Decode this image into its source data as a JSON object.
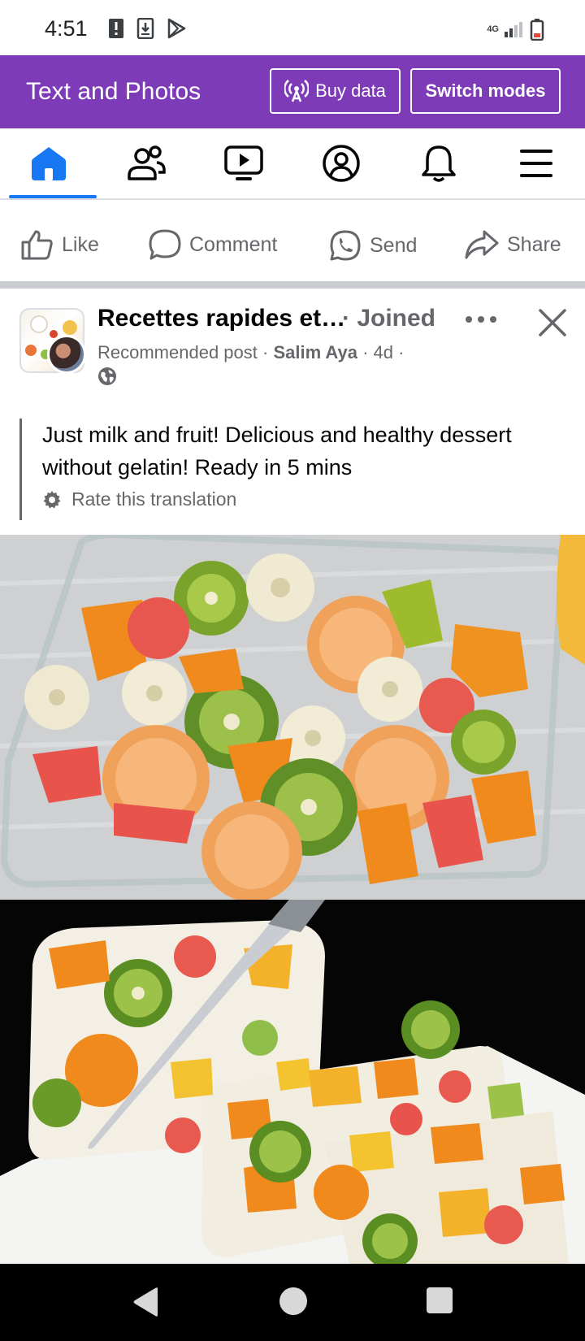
{
  "status_bar": {
    "time": "4:51",
    "network": "4G"
  },
  "header": {
    "title": "Text and Photos",
    "buy_data_label": "Buy data",
    "switch_modes_label": "Switch modes",
    "background_color": "#7d3bb8"
  },
  "nav": {
    "items": [
      {
        "name": "home-icon",
        "active": true
      },
      {
        "name": "friends-icon",
        "active": false
      },
      {
        "name": "video-icon",
        "active": false
      },
      {
        "name": "profile-icon",
        "active": false
      },
      {
        "name": "notifications-icon",
        "active": false
      },
      {
        "name": "menu-icon",
        "active": false
      }
    ],
    "active_color": "#1877f2"
  },
  "actions": {
    "like": "Like",
    "comment": "Comment",
    "send": "Send",
    "share": "Share"
  },
  "post": {
    "group_name": "Recettes rapides et…",
    "joined": "· Joined",
    "recommended": "Recommended post · ",
    "author": "Salim Aya",
    "time": " · 4d ·",
    "text": "Just milk and fruit! Delicious and healthy dessert without gelatin! Ready in 5 mins",
    "rate_translation": "Rate this translation"
  }
}
